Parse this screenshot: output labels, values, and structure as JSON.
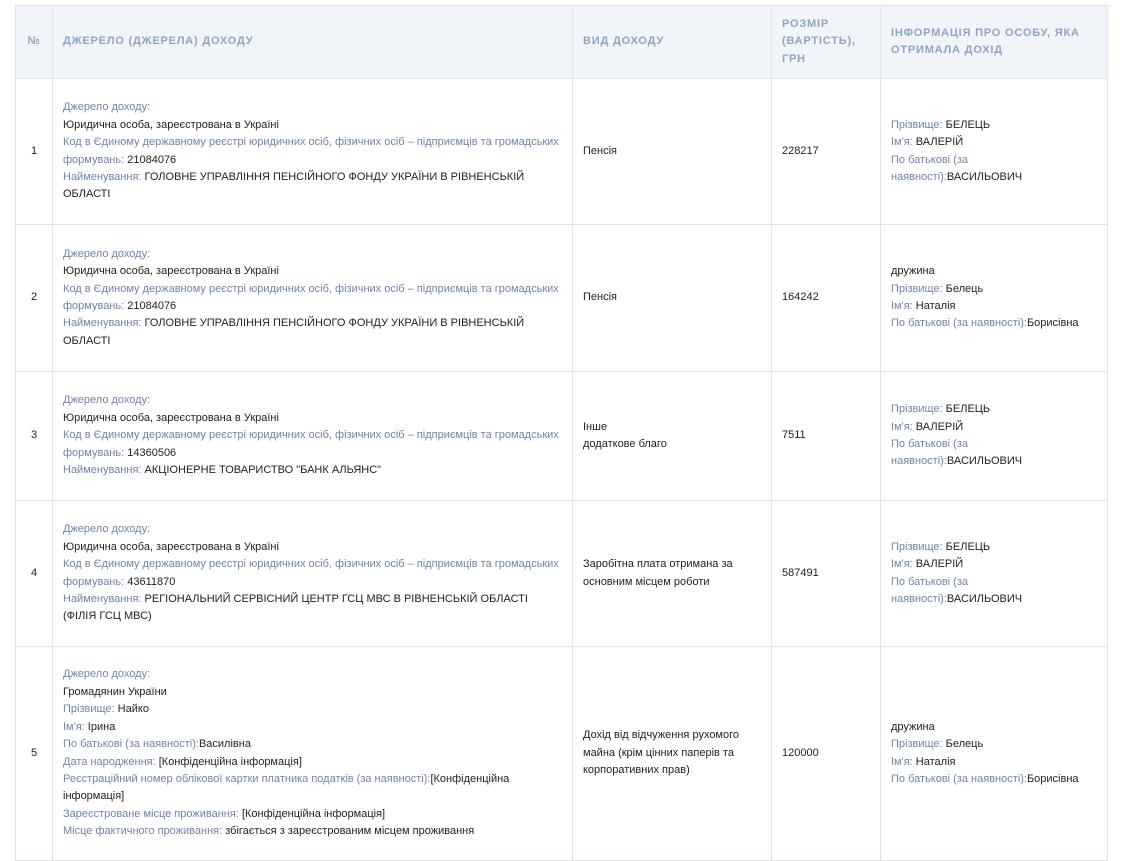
{
  "headers": {
    "num": "№",
    "source": "Джерело (джерела) доходу",
    "type": "Вид доходу",
    "amount": "Розмір (вартість), грн",
    "person": "Інформація про особу, яка отримала дохід"
  },
  "labels": {
    "source": "Джерело доходу:",
    "code": "Код в Єдиному державному реєстрі юридичних осіб, фізичних осіб – підприємців та громадських формувань:",
    "name": "Найменування:",
    "surname": "Прізвище:",
    "firstname": "Ім'я:",
    "patronymic": "По батькові (за наявності):",
    "birthdate": "Дата народження:",
    "taxnum": "Реєстраційний номер облікової картки платника податків (за наявності):",
    "regaddress": "Зареєстроване місце проживання:",
    "actualaddress": "Місце фактичного проживання:"
  },
  "rows": [
    {
      "num": "1",
      "source_kind": "Юридична особа, зареєстрована в Україні",
      "code": "21084076",
      "name": "ГОЛОВНЕ УПРАВЛІННЯ ПЕНСІЙНОГО ФОНДУ УКРАЇНИ В РІВНЕНСЬКІЙ ОБЛАСТІ",
      "type": "Пенсія",
      "amount": "228217",
      "person": {
        "relation": "",
        "surname": "БЕЛЕЦЬ",
        "firstname": "ВАЛЕРІЙ",
        "patronymic": "ВАСИЛЬОВИЧ"
      }
    },
    {
      "num": "2",
      "source_kind": "Юридична особа, зареєстрована в Україні",
      "code": "21084076",
      "name": "ГОЛОВНЕ УПРАВЛІННЯ ПЕНСІЙНОГО ФОНДУ УКРАЇНИ В РІВНЕНСЬКІЙ ОБЛАСТІ",
      "type": "Пенсія",
      "amount": "164242",
      "person": {
        "relation": "дружина",
        "surname": "Белець",
        "firstname": "Наталія",
        "patronymic": "Борисівна"
      }
    },
    {
      "num": "3",
      "source_kind": "Юридична особа, зареєстрована в Україні",
      "code": "14360506",
      "name": "АКЦІОНЕРНЕ ТОВАРИСТВО \"БАНК АЛЬЯНС\"",
      "type": "Інше",
      "type_extra": "додаткове благо",
      "amount": "7511",
      "person": {
        "relation": "",
        "surname": "БЕЛЕЦЬ",
        "firstname": "ВАЛЕРІЙ",
        "patronymic": "ВАСИЛЬОВИЧ"
      }
    },
    {
      "num": "4",
      "source_kind": "Юридична особа, зареєстрована в Україні",
      "code": "43611870",
      "name": "РЕГІОНАЛЬНИЙ СЕРВІСНИЙ ЦЕНТР ГСЦ МВС В РІВНЕНСЬКІЙ ОБЛАСТІ (ФІЛІЯ ГСЦ МВС)",
      "type": "Заробітна плата отримана за основним місцем роботи",
      "amount": "587491",
      "person": {
        "relation": "",
        "surname": "БЕЛЕЦЬ",
        "firstname": "ВАЛЕРІЙ",
        "patronymic": "ВАСИЛЬОВИЧ"
      }
    },
    {
      "num": "5",
      "source_kind": "Громадянин України",
      "surname": "Найко",
      "firstname": "Ірина",
      "patronymic": "Василівна",
      "birthdate": "[Конфіденційна інформація]",
      "taxnum": "[Конфіденційна інформація]",
      "regaddress": "[Конфіденційна інформація]",
      "actualaddress": "збігається з зареєстрованим місцем проживання",
      "type": "Дохід від відчуження рухомого майна (крім цінних паперів та корпоративних прав)",
      "amount": "120000",
      "person": {
        "relation": "дружина",
        "surname": "Белець",
        "firstname": "Наталія",
        "patronymic": "Борисівна"
      }
    }
  ]
}
